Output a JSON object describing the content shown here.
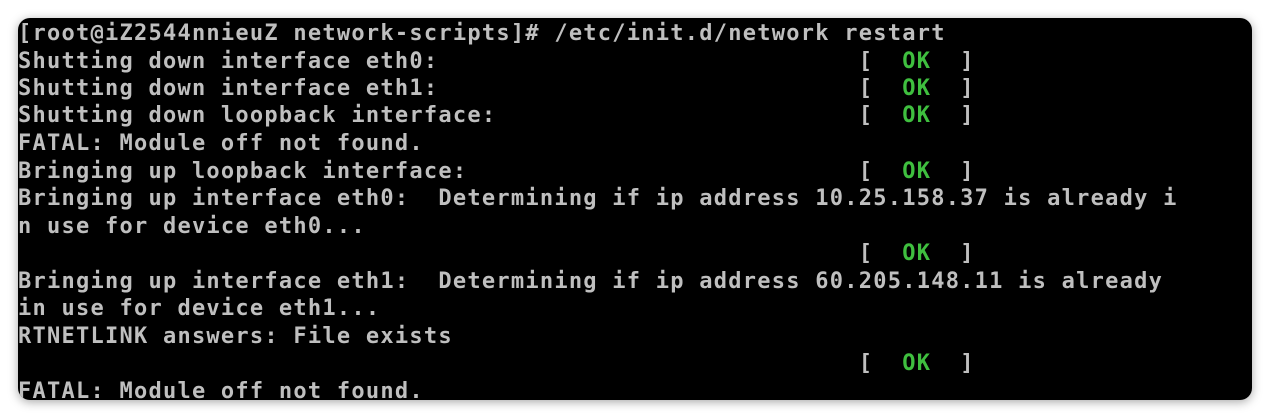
{
  "terminal": {
    "lines": [
      {
        "text": "[root@iZ2544nnieuZ network-scripts]# /etc/init.d/network restart"
      },
      {
        "text": "Shutting down interface eth0:                             [  ",
        "status": "OK",
        "tail": "  ]"
      },
      {
        "text": "Shutting down interface eth1:                             [  ",
        "status": "OK",
        "tail": "  ]"
      },
      {
        "text": "Shutting down loopback interface:                         [  ",
        "status": "OK",
        "tail": "  ]"
      },
      {
        "text": "FATAL: Module off not found."
      },
      {
        "text": "Bringing up loopback interface:                           [  ",
        "status": "OK",
        "tail": "  ]"
      },
      {
        "text": "Bringing up interface eth0:  Determining if ip address 10.25.158.37 is already i"
      },
      {
        "text": "n use for device eth0..."
      },
      {
        "text": "                                                          [  ",
        "status": "OK",
        "tail": "  ]"
      },
      {
        "text": "Bringing up interface eth1:  Determining if ip address 60.205.148.11 is already"
      },
      {
        "text": "in use for device eth1..."
      },
      {
        "text": "RTNETLINK answers: File exists"
      },
      {
        "text": "                                                          [  ",
        "status": "OK",
        "tail": "  ]"
      },
      {
        "text": "FATAL: Module off not found."
      }
    ],
    "colors": {
      "text": "#bfbfbf",
      "ok": "#3fbf3f",
      "background": "#000000"
    }
  }
}
